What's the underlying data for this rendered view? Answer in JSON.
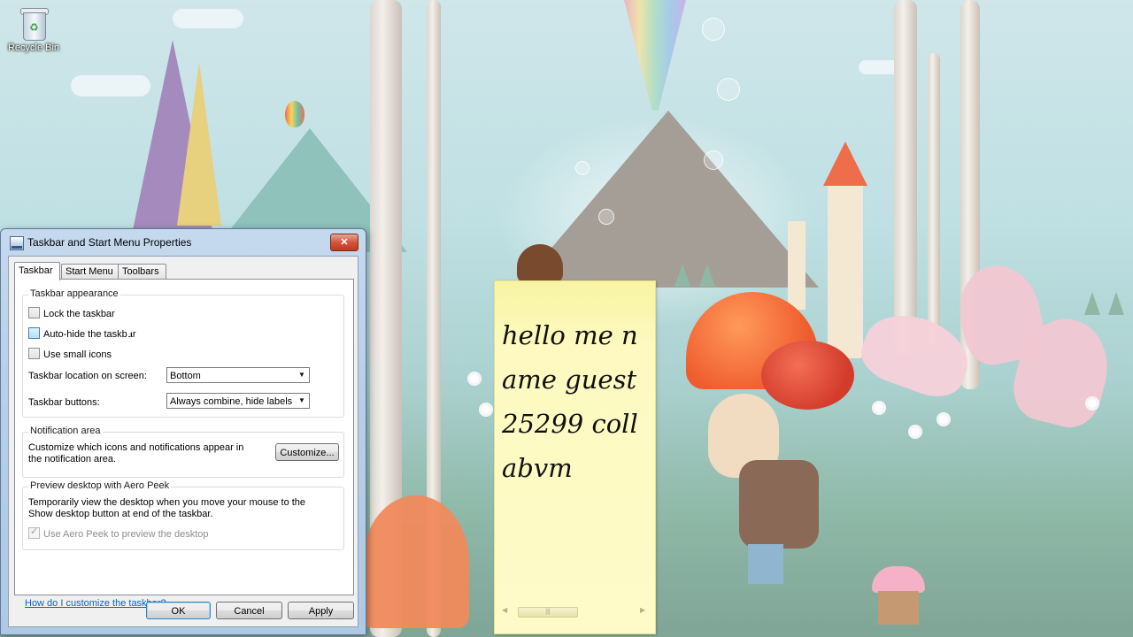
{
  "desktop": {
    "recycle_bin_label": "Recycle Bin"
  },
  "dialog": {
    "title": "Taskbar and Start Menu Properties",
    "close_glyph": "✕",
    "tabs": [
      {
        "label": "Taskbar",
        "active": true
      },
      {
        "label": "Start Menu",
        "active": false
      },
      {
        "label": "Toolbars",
        "active": false
      }
    ],
    "taskbar_appearance": {
      "title": "Taskbar appearance",
      "lock_label": "Lock the taskbar",
      "lock_checked": false,
      "autohide_label": "Auto-hide the taskbar",
      "autohide_checked": false,
      "small_icons_label": "Use small icons",
      "small_icons_checked": false,
      "location_label": "Taskbar location on screen:",
      "location_value": "Bottom",
      "buttons_label": "Taskbar buttons:",
      "buttons_value": "Always combine, hide labels"
    },
    "notification_area": {
      "title": "Notification area",
      "description": "Customize which icons and notifications appear in the notification area.",
      "customize_button": "Customize..."
    },
    "aero_peek": {
      "title": "Preview desktop with Aero Peek",
      "description": "Temporarily view the desktop when you move your mouse to the Show desktop button at end of the taskbar.",
      "checkbox_label": "Use Aero Peek to preview the desktop",
      "checked": true,
      "disabled": true
    },
    "help_link": "How do I customize the taskbar?",
    "buttons": {
      "ok": "OK",
      "cancel": "Cancel",
      "apply": "Apply"
    }
  },
  "sticky_note": {
    "text": "hello me name guest25299 collabvm",
    "scroll_grip": "|||"
  },
  "colors": {
    "link": "#0066cc",
    "sticky_bg": "#fefbc9",
    "close_button": "#d0563c"
  }
}
